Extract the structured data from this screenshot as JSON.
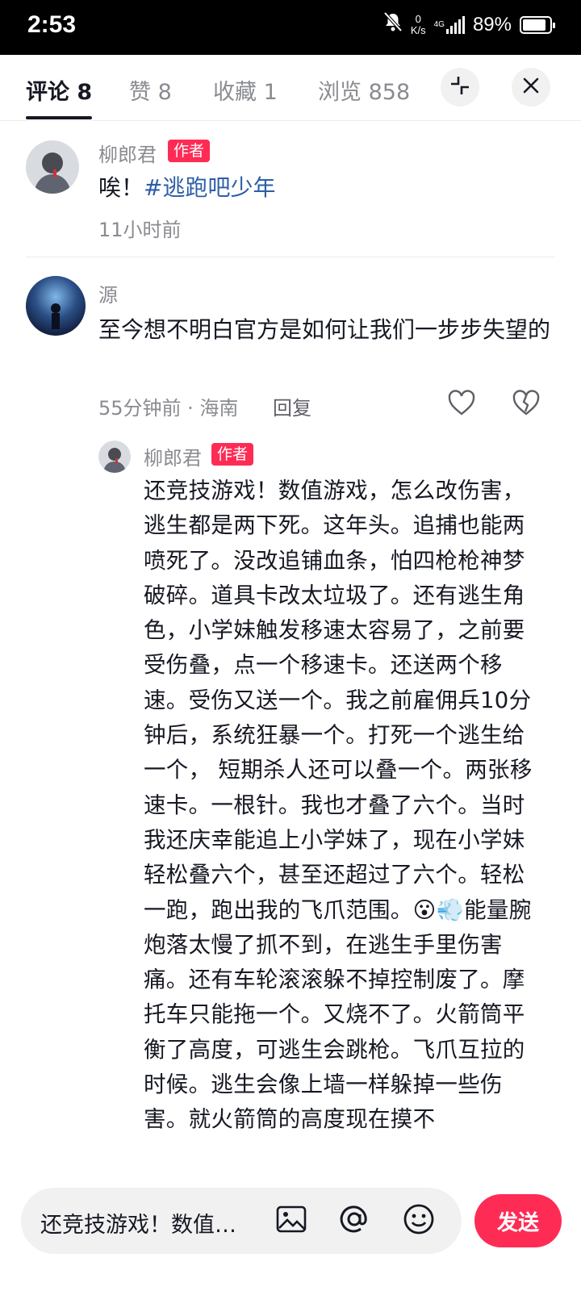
{
  "status_bar": {
    "time": "2:53",
    "net_speed_value": "0",
    "net_speed_unit": "K/s",
    "network_type": "4G",
    "battery_text": "89%",
    "battery_level": 0.89
  },
  "tabs": [
    {
      "label": "评论 8",
      "active": true
    },
    {
      "label": "赞 8",
      "active": false
    },
    {
      "label": "收藏 1",
      "active": false
    },
    {
      "label": "浏览 858",
      "active": false
    }
  ],
  "comments": [
    {
      "user": "柳郎君",
      "badge": "作者",
      "text_prefix": "唉！",
      "hashtag": "#逃跑吧少年",
      "time": "11小时前"
    },
    {
      "user": "源",
      "text": "至今想不明白官方是如何让我们一步步失望的",
      "time": "55分钟前",
      "location": "海南",
      "reply_label": "回复",
      "reply": {
        "user": "柳郎君",
        "badge": "作者",
        "text": "还竞技游戏！数值游戏，怎么改伤害，逃生都是两下死。这年头。追捕也能两喷死了。没改追铺血条，怕四枪枪神梦破碎。道具卡改太垃圾了。还有逃生角色，小学妹触发移速太容易了，之前要受伤叠，点一个移速卡。还送两个移速。受伤又送一个。我之前雇佣兵10分钟后，系统狂暴一个。打死一个逃生给一个， 短期杀人还可以叠一个。两张移速卡。一根针。我也才叠了六个。当时我还庆幸能追上小学妹了，现在小学妹轻松叠六个，甚至还超过了六个。轻松一跑，跑出我的飞爪范围。😮💨能量腕炮落太慢了抓不到，在逃生手里伤害痛。还有车轮滚滚躲不掉控制废了。摩托车只能拖一个。又烧不了。火箭筒平衡了高度，可逃生会跳枪。飞爪互拉的时候。逃生会像上墙一样躲掉一些伤害。就火箭筒的高度现在摸不"
      }
    }
  ],
  "input": {
    "draft_text": "还竞技游戏！数值…",
    "send_label": "发送"
  },
  "colors": {
    "accent": "#fe2c55",
    "hashtag": "#2c5ea8",
    "secondary_text": "#8a8b91"
  },
  "icons": [
    "collapse-icon",
    "close-icon",
    "heart-icon",
    "broken-heart-icon",
    "image-icon",
    "at-icon",
    "emoji-icon",
    "mute-bell-icon"
  ]
}
